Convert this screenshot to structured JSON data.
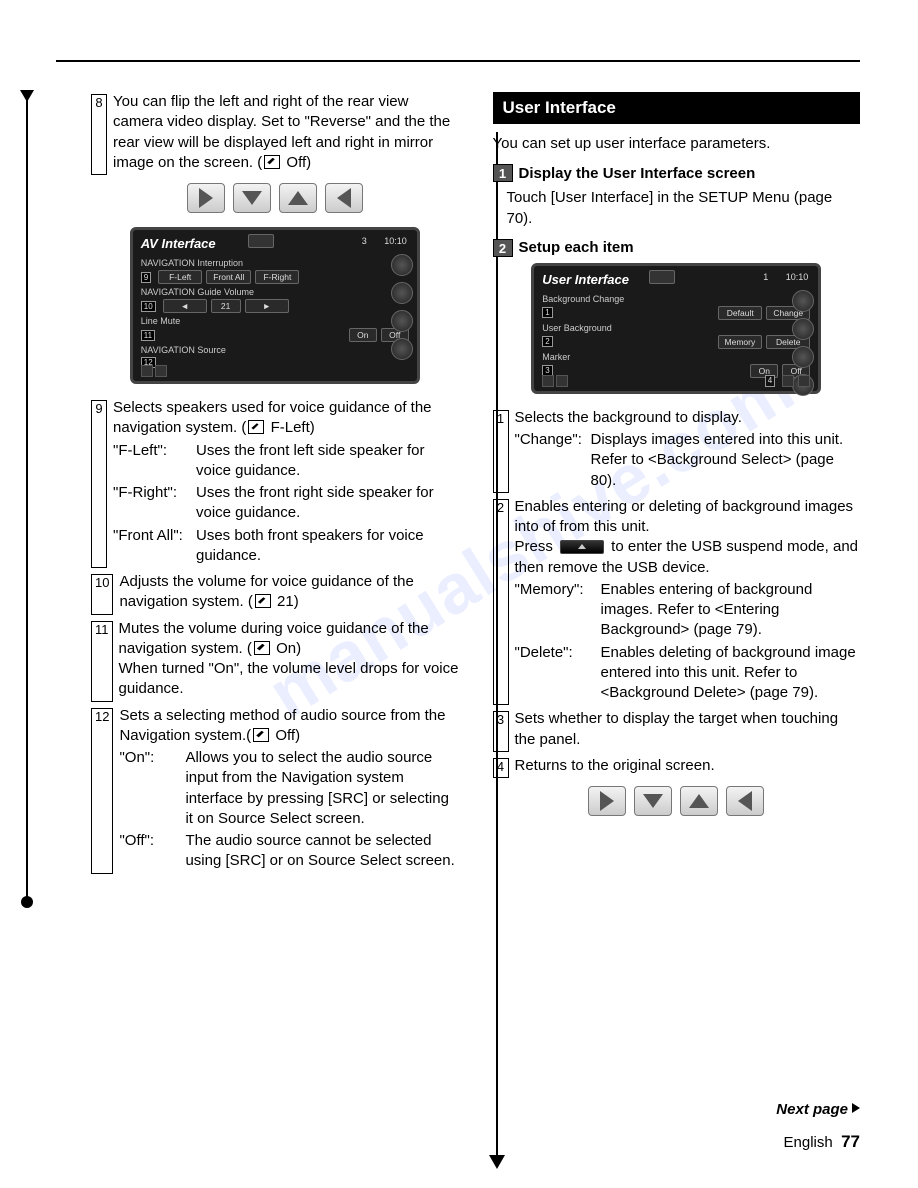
{
  "left": {
    "item8": {
      "num": "8",
      "text": "You can flip the left and right of the rear view camera video display. Set to \"Reverse\" and the the rear view will be displayed left and right in mirror image on the screen. (",
      "default": "Off)"
    },
    "screen1": {
      "title": "AV Interface",
      "page": "3",
      "time": "10:10",
      "row1_label": "NAVIGATION Interruption",
      "row1_num": "9",
      "row1_btns": [
        "F-Left",
        "Front All",
        "F-Right"
      ],
      "row2_label": "NAVIGATION Guide Volume",
      "row2_num": "10",
      "row2_val": "21",
      "row3_label": "Line Mute",
      "row3_num": "11",
      "row3_btns": [
        "On",
        "Off"
      ],
      "row4_label": "NAVIGATION Source",
      "row4_num": "12"
    },
    "item9": {
      "num": "9",
      "text": "Selects speakers used for voice guidance of the navigation system. (",
      "default": "F-Left)",
      "d1_term": "\"F-Left\":",
      "d1_desc": "Uses the front left side speaker for voice guidance.",
      "d2_term": "\"F-Right\":",
      "d2_desc": "Uses the front right side speaker for voice guidance.",
      "d3_term": "\"Front All\":",
      "d3_desc": "Uses both front speakers for voice guidance."
    },
    "item10": {
      "num": "10",
      "text": "Adjusts the volume for voice guidance of the navigation system. (",
      "default": "21)"
    },
    "item11": {
      "num": "11",
      "text1": "Mutes the volume during voice guidance of the navigation system. (",
      "default": "On)",
      "text2": "When turned \"On\", the volume level drops for voice guidance."
    },
    "item12": {
      "num": "12",
      "text": "Sets a selecting method of audio source from the Navigation system.(",
      "default": "Off)",
      "d1_term": "\"On\":",
      "d1_desc": "Allows you to select the audio source input from the Navigation system interface by pressing [SRC] or selecting it on Source Select screen.",
      "d2_term": "\"Off\":",
      "d2_desc": "The audio source cannot be selected using [SRC] or on Source Select screen."
    }
  },
  "right": {
    "section_title": "User Interface",
    "intro": "You can set up user interface parameters.",
    "step1_num": "1",
    "step1_title": "Display the User Interface screen",
    "step1_text": "Touch [User Interface] in the SETUP Menu (page 70).",
    "step2_num": "2",
    "step2_title": "Setup each item",
    "screen2": {
      "title": "User Interface",
      "page": "1",
      "time": "10:10",
      "row1_label": "Background Change",
      "row1_num": "1",
      "row1_btns": [
        "Default",
        "Change"
      ],
      "row2_label": "User Background",
      "row2_num": "2",
      "row2_btns": [
        "Memory",
        "Delete"
      ],
      "row3_label": "Marker",
      "row3_num": "3",
      "row3_btns": [
        "On",
        "Off"
      ],
      "bottom_num": "4"
    },
    "item1": {
      "num": "1",
      "text": "Selects the background to display.",
      "d1_term": "\"Change\":",
      "d1_desc": "Displays images entered into this unit. Refer to <Background Select> (page 80)."
    },
    "item2": {
      "num": "2",
      "text1": "Enables entering or deleting of background images into of from this unit.",
      "text2a": "Press ",
      "text2b": " to enter the USB suspend mode, and then remove the USB device.",
      "d1_term": "\"Memory\":",
      "d1_desc": "Enables entering of background images. Refer to <Entering Background> (page 79).",
      "d2_term": "\"Delete\":",
      "d2_desc": "Enables deleting of background image entered into this unit. Refer to <Background Delete> (page 79)."
    },
    "item3": {
      "num": "3",
      "text": "Sets whether to display the target when touching the panel."
    },
    "item4": {
      "num": "4",
      "text": "Returns to the original screen."
    }
  },
  "footer": {
    "next": "Next page",
    "lang": "English",
    "page": "77"
  },
  "watermark": "manualshive.com"
}
